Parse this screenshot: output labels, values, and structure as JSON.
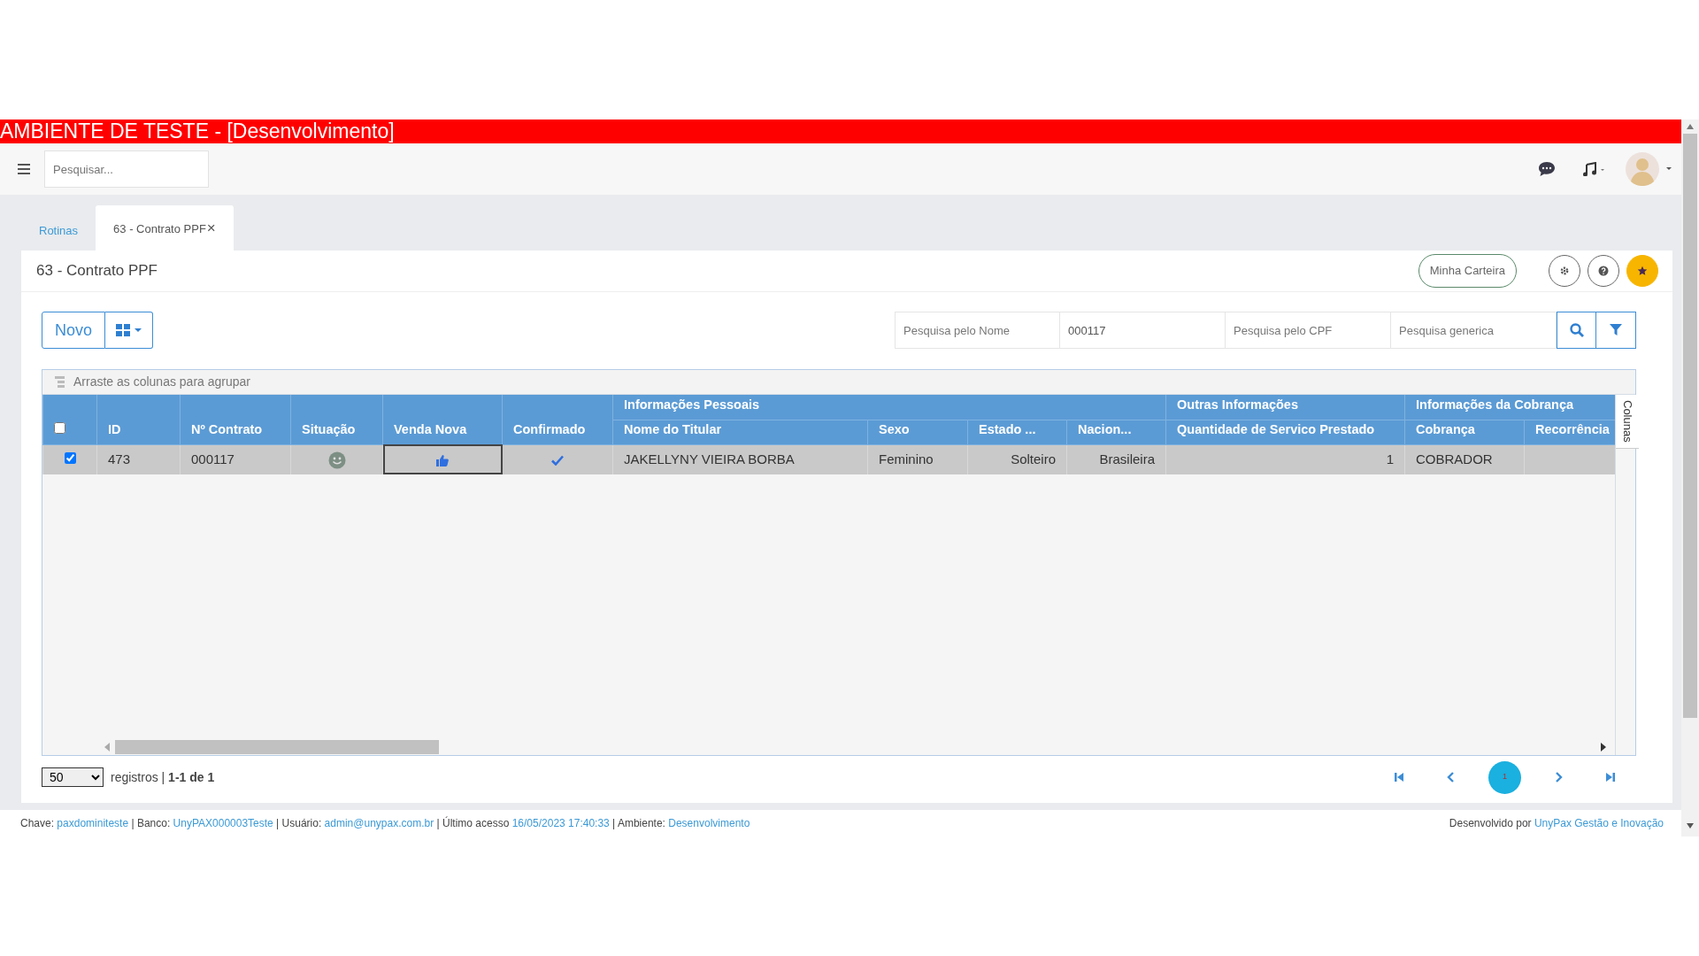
{
  "env_banner": "AMBIENTE DE TESTE - [Desenvolvimento]",
  "topbar": {
    "search": {
      "placeholder": "Pesquisar..."
    }
  },
  "tabs": [
    {
      "label": "Rotinas",
      "selected": false
    },
    {
      "label": "63 - Contrato PPF",
      "selected": true,
      "close": "×"
    }
  ],
  "page": {
    "title": "63 - Contrato PPF",
    "wallet_button": "Minha Carteira"
  },
  "toolbar": {
    "new_button": "Novo",
    "filters": [
      {
        "placeholder": "Pesquisa pelo Nome"
      },
      {
        "value": "000117"
      },
      {
        "placeholder": "Pesquisa pelo CPF"
      },
      {
        "placeholder": "Pesquisa generica"
      }
    ]
  },
  "grid": {
    "group_hint": "Arraste as colunas para agrupar",
    "select_all_checked": false,
    "header": [
      {
        "kind": "single",
        "label": "ID"
      },
      {
        "kind": "single",
        "label": "Nº Contrato"
      },
      {
        "kind": "single",
        "label": "Situação"
      },
      {
        "kind": "single",
        "label": "Venda Nova"
      },
      {
        "kind": "single",
        "label": "Confirmado"
      },
      {
        "kind": "group",
        "label": "Informações Pessoais",
        "columns": [
          {
            "label": "Nome do Titular"
          },
          {
            "label": "Sexo"
          },
          {
            "label": "Estado ..."
          },
          {
            "label": "Nacion..."
          }
        ]
      },
      {
        "kind": "group",
        "label": "Outras Informações",
        "columns": [
          {
            "label": "Quantidade de Servico Prestado"
          }
        ]
      },
      {
        "kind": "group",
        "label": "Informações da Cobrança",
        "columns": [
          {
            "label": "Cobrança"
          },
          {
            "label": "Recorrência"
          }
        ]
      }
    ],
    "rows": [
      {
        "checked": true,
        "cells": [
          {
            "kind": "text",
            "text": "473",
            "focused": false
          },
          {
            "kind": "text",
            "text": "000117",
            "focused": false
          },
          {
            "kind": "smiley",
            "focused": false
          },
          {
            "kind": "thumbs_up",
            "focused": true
          },
          {
            "kind": "check",
            "focused": false
          },
          {
            "kind": "text",
            "text": "JAKELLYNY VIEIRA BORBA",
            "focused": false
          },
          {
            "kind": "text",
            "text": "Feminino",
            "focused": false
          },
          {
            "kind": "text",
            "text": "Solteiro",
            "focused": false
          },
          {
            "kind": "text",
            "text": "Brasileira",
            "focused": false
          },
          {
            "kind": "text",
            "text": "1",
            "focused": false
          },
          {
            "kind": "text",
            "text": "COBRADOR",
            "focused": false
          },
          {
            "kind": "empty",
            "focused": false
          }
        ]
      }
    ],
    "columns_tab": "Colunas"
  },
  "pager": {
    "page_size": "50",
    "summary_label": "registros",
    "separator": "|",
    "range": "1-1 de 1",
    "pages": [
      {
        "label": "1",
        "selected": true
      }
    ]
  },
  "footer": {
    "separator": "|",
    "items": [
      {
        "label": "Chave:",
        "value": "paxdominiteste"
      },
      {
        "label": "Banco:",
        "value": "UnyPAX000003Teste"
      },
      {
        "label": "Usuário:",
        "value": "admin@unypax.com.br"
      },
      {
        "label": "Último acesso",
        "value": "16/05/2023 17:40:33"
      },
      {
        "label": "Ambiente:",
        "value": "Desenvolvimento"
      }
    ],
    "credit": {
      "label": "Desenvolvido por",
      "value": "UnyPax Gestão e Inovação"
    }
  }
}
